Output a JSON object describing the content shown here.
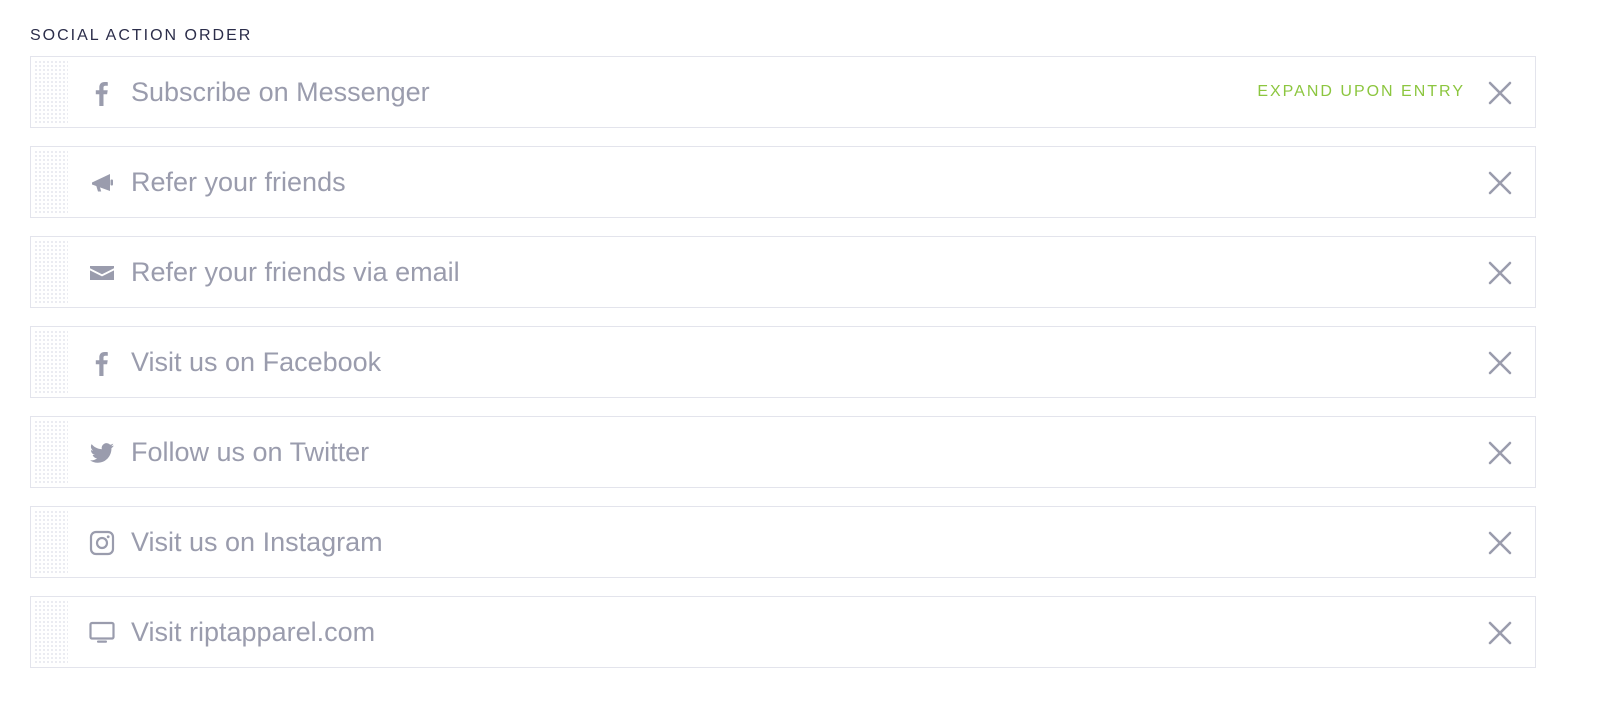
{
  "section": {
    "title": "SOCIAL ACTION ORDER"
  },
  "colors": {
    "label": "#9a9cad",
    "accent": "#8cc63f",
    "border": "#e3e4ec",
    "title": "#2b2d4a"
  },
  "actions": [
    {
      "label": "Subscribe on Messenger",
      "icon": "facebook-icon",
      "expand_label": "EXPAND UPON ENTRY"
    },
    {
      "label": "Refer your friends",
      "icon": "megaphone-icon"
    },
    {
      "label": "Refer your friends via email",
      "icon": "envelope-icon"
    },
    {
      "label": "Visit us on Facebook",
      "icon": "facebook-icon"
    },
    {
      "label": "Follow us on Twitter",
      "icon": "twitter-icon"
    },
    {
      "label": "Visit us on Instagram",
      "icon": "instagram-icon"
    },
    {
      "label": "Visit riptapparel.com",
      "icon": "monitor-icon"
    }
  ]
}
